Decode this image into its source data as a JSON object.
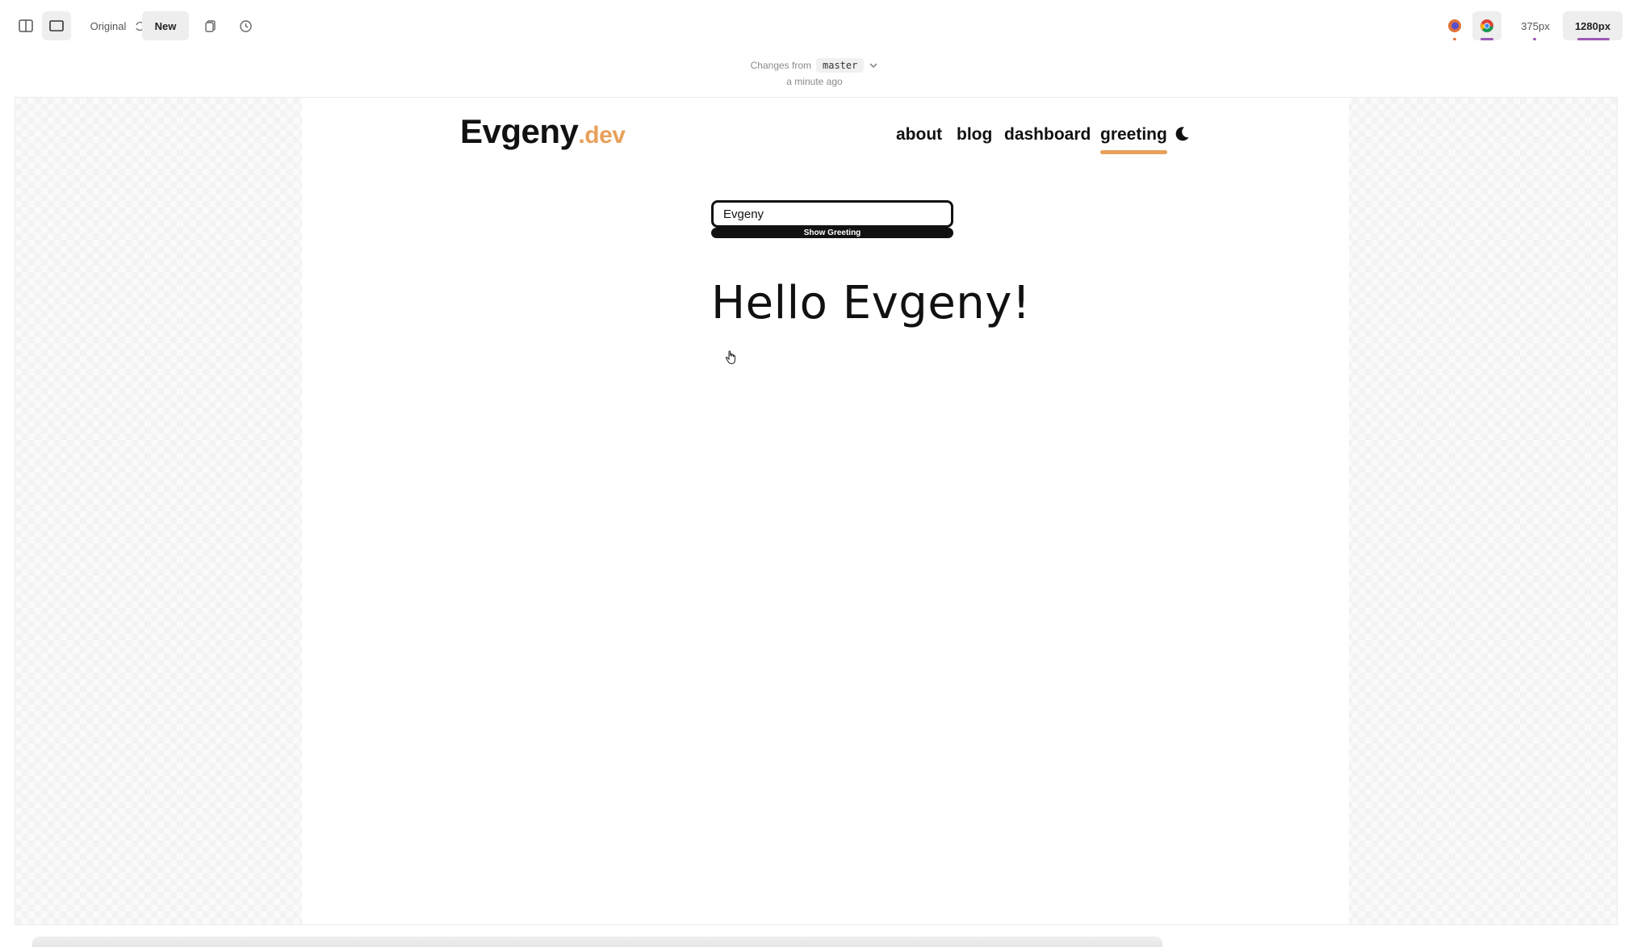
{
  "toolbar": {
    "split_view_icon": "split-view-icon",
    "single_view_icon": "single-view-icon",
    "original_label": "Original",
    "swap_icon": "swap-icon",
    "new_label": "New",
    "copy_icon": "copy-icon",
    "history_icon": "history-icon",
    "browsers": [
      "firefox-icon",
      "chrome-icon"
    ],
    "viewport_small": "375px",
    "viewport_large": "1280px"
  },
  "changes": {
    "prefix": "Changes from",
    "branch": "master",
    "time": "a minute ago"
  },
  "site": {
    "logo_name": "Evgeny",
    "logo_tld": ".dev",
    "nav": [
      "about",
      "blog",
      "dashboard",
      "greeting"
    ],
    "active_nav": "greeting",
    "theme_icon": "moon-icon",
    "input_value": "Evgeny",
    "button_label": "Show Greeting",
    "greeting": "Hello Evgeny!"
  },
  "colors": {
    "accent": "#e8a05a",
    "text": "#111111",
    "firefox_underline": "#e0733a",
    "chrome_underline": "#9b59b6"
  }
}
